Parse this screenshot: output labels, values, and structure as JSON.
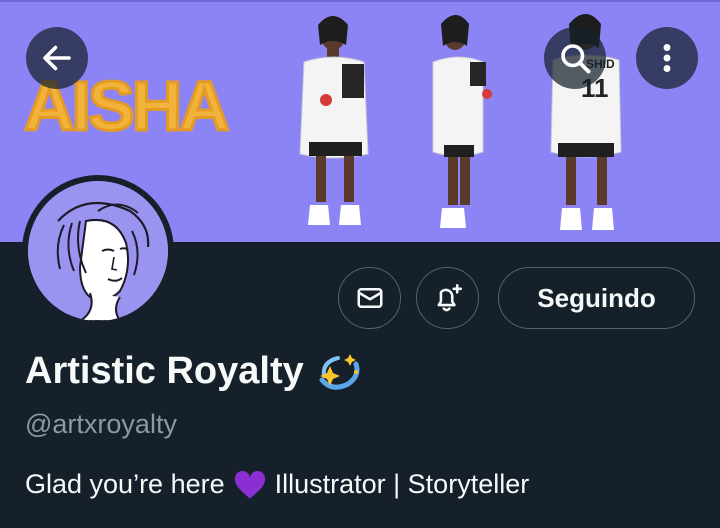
{
  "header": {
    "banner_text": "AISHA",
    "banner_color": "#8c84f5",
    "back_icon": "arrow-left-icon",
    "search_icon": "search-icon",
    "more_icon": "more-vertical-icon"
  },
  "profile": {
    "display_name": "Artistic Royalty",
    "name_emoji": "sparkle-emoji",
    "handle": "@artxroyalty",
    "bio_start": "Glad you’re here",
    "bio_emoji": "purple-heart-emoji",
    "bio_end": "Illustrator | Storyteller",
    "jersey_text": "SHID",
    "jersey_number": "11"
  },
  "actions": {
    "message_icon": "envelope-icon",
    "notify_icon": "bell-plus-icon",
    "follow_label": "Seguindo"
  },
  "colors": {
    "background": "#15202b",
    "text_primary": "#f7f9f9",
    "text_secondary": "#8b98a5",
    "border": "#536471"
  }
}
